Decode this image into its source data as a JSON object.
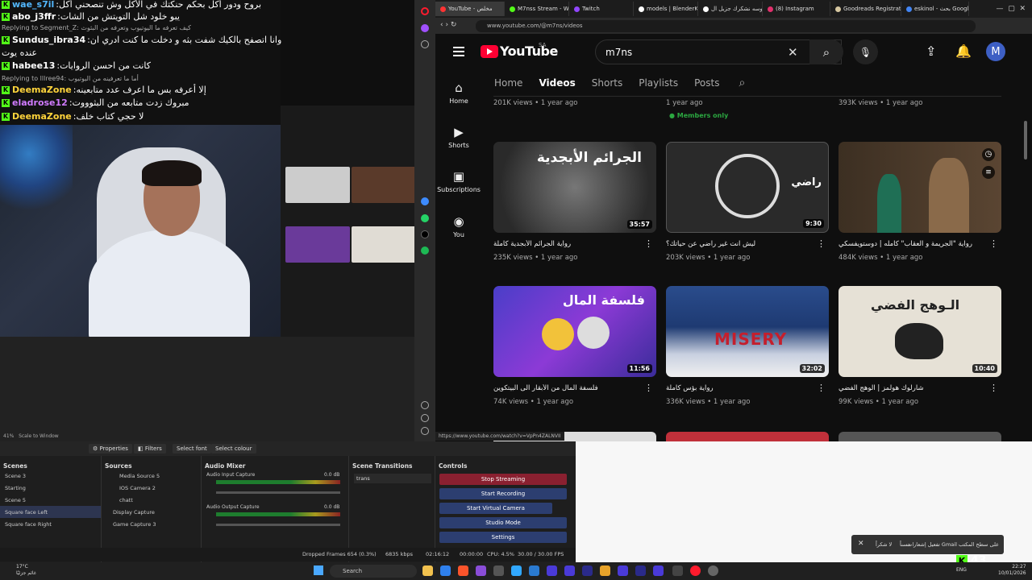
{
  "chat": {
    "lines": [
      {
        "user": "wae_s7il",
        "color": "#53b8ff",
        "msg": "بروح ودور أكل بحكم حنكتك في الأكل وش تنصحني أكل"
      },
      {
        "user": "abo_j3ffr",
        "color": "#ffffff",
        "msg": "يبو خلود شل التويتش من الشات"
      },
      {
        "reply_label": "Replying to",
        "reply_text": "Segment_Z: كيف تعرفه ما اليوتيوب وتعرفه من البثوث"
      },
      {
        "user": "Sundus_ibra34",
        "color": "#ffffff",
        "msg": "وانا اتصفح بالكيك شفت بثه و دخلت ما كنت ادري ان"
      },
      {
        "msg": "عنده يوت"
      },
      {
        "user": "habee13",
        "color": "#ffffff",
        "msg": "كانت من احسن الروايات"
      },
      {
        "reply_label": "Replying to",
        "reply_text": "lllree94: أما ما تعرفينه من اليوتيوب"
      },
      {
        "user": "DeemaZone",
        "color": "#ffd43b",
        "msg": "إلا أعرفه بس ما اعرف عدد متابعينه"
      },
      {
        "user": "eladrose12",
        "color": "#d07bff",
        "msg": "مبروك زدت متابعه من البثوووت"
      },
      {
        "user": "DeemaZone",
        "color": "#ffd43b",
        "msg": "لا حجي كتاب خلف"
      }
    ]
  },
  "browser": {
    "tabs": [
      {
        "label": "YouTube - مخلص",
        "color": "#ff3333",
        "active": true
      },
      {
        "label": "M7nss Stream - Watch",
        "color": "#53fc18"
      },
      {
        "label": "Twitch",
        "color": "#9146ff"
      },
      {
        "label": "models | BlenderKit",
        "color": "#ffffff"
      },
      {
        "label": "يا خيوسه نشكرك جزيل ال...",
        "color": "#ffffff"
      },
      {
        "label": "(8) Instagram",
        "color": "#e1306c"
      },
      {
        "label": "Goodreads Registration",
        "color": "#d6c7a1"
      },
      {
        "label": "eskinol - بحث Google",
        "color": "#4285f4"
      }
    ],
    "url": "www.youtube.com/@m7ns/videos",
    "status_url": "https://www.youtube.com/watch?v=VpPn4ZALNVII"
  },
  "youtube": {
    "logo": "YouTube",
    "region": "SA",
    "search_value": "m7ns",
    "avatar_letter": "M",
    "nav": [
      {
        "label": "Home",
        "icon": "⌂"
      },
      {
        "label": "Shorts",
        "icon": "▶"
      },
      {
        "label": "Subscriptions",
        "icon": "▣"
      },
      {
        "label": "You",
        "icon": "◉"
      }
    ],
    "tabs": [
      "Home",
      "Videos",
      "Shorts",
      "Playlists",
      "Posts"
    ],
    "prev_row": {
      "m1": "201K views • 1 year ago",
      "m2": "1 year ago",
      "members": "Members only",
      "m3": "393K views • 1 year ago"
    },
    "videos": [
      {
        "title": "رواية الجرائم الأبجدية كاملة",
        "meta": "235K views • 1 year ago",
        "duration": "35:57",
        "thumb_text": "الجرائم الأبجدية"
      },
      {
        "title": "ليش انت غير راضي عن حياتك؟",
        "meta": "203K views • 1 year ago",
        "duration": "9:30",
        "thumb_text": "راضي"
      },
      {
        "title": "رواية \"الجريمة و العقاب\" كامله | دوستويفسكي",
        "meta": "484K views • 1 year ago",
        "duration": "",
        "thumb_text": ""
      },
      {
        "title": "فلسفة المال من الأبقار الى البيتكوين",
        "meta": "74K views • 1 year ago",
        "duration": "11:56",
        "thumb_text": "فلسفة المال"
      },
      {
        "title": "رواية بؤس كاملة",
        "meta": "336K views • 1 year ago",
        "duration": "32:02",
        "thumb_text": "MISERY"
      },
      {
        "title": "شارلوك هولمز | الوهج الفضي",
        "meta": "99K views • 1 year ago",
        "duration": "10:40",
        "thumb_text": "الـوهج الفضي"
      }
    ]
  },
  "obs": {
    "toolbar": {
      "properties": "Properties",
      "filters": "Filters",
      "select_font": "Select font",
      "select_colour": "Select colour"
    },
    "zoom": "41%",
    "scale": "Scale to Window",
    "scenes_title": "Scenes",
    "scenes": [
      "Scene 3",
      "Starting",
      "Scene 5",
      "Square face Left",
      "Square face Right"
    ],
    "sources_title": "Sources",
    "sources": [
      "Media Source 5",
      "IOS Camera 2",
      "chatt",
      "Display Capture",
      "Game Capture 3"
    ],
    "mixer_title": "Audio Mixer",
    "mixer": [
      {
        "name": "Audio Input Capture",
        "db": "0.0 dB"
      },
      {
        "name": "Audio Output Capture",
        "db": "0.0 dB"
      }
    ],
    "transitions_title": "Scene Transitions",
    "transition": "trans",
    "controls_title": "Controls",
    "controls": [
      "Stop Streaming",
      "Start Recording",
      "Start Virtual Camera",
      "Studio Mode",
      "Settings"
    ],
    "status": {
      "dropped": "Dropped Frames 654 (0.3%)",
      "kbps": "6835 kbps",
      "live": "02:16:12",
      "rec": "00:00:00",
      "cpu": "CPU: 4.5%",
      "fps": "30.00 / 30.00 FPS"
    }
  },
  "notification": {
    "text": "تفعيل إشعارات Gmail على سطح المكتب",
    "action1": "حسناً",
    "action2": "لا شكراً"
  },
  "kick_viewers": "43",
  "taskbar": {
    "weather_temp": "17°C",
    "weather_desc": "غائم جزئيًا",
    "search": "Search",
    "lang": "ENG",
    "time": "22:27",
    "date": "10/01/2026"
  }
}
